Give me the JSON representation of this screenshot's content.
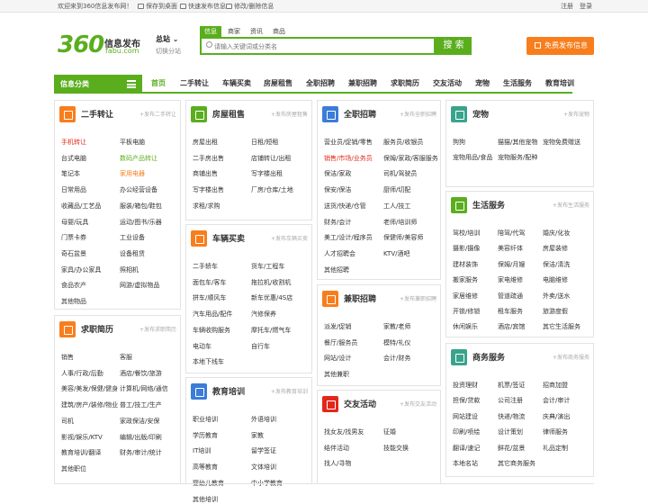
{
  "topbar": {
    "welcome": "欢迎来到360信息发布网！",
    "save_desktop": "保存到桌面",
    "quick_publish": "快速发布信息",
    "edit_delete": "修改/删除信息",
    "register": "注册",
    "login": "登录"
  },
  "logo": {
    "num": "360",
    "cn": "信息发布",
    "en": "fabu.com"
  },
  "city": {
    "name": "总站",
    "switch": "切换分站"
  },
  "search": {
    "tabs": [
      "信息",
      "商家",
      "资讯",
      "商品"
    ],
    "placeholder": "请输入关键词或分类名",
    "button": "搜 索"
  },
  "publish_button": "免费发布信息",
  "category_bar": "信息分类",
  "nav": [
    "首页",
    "二手转让",
    "车辆买卖",
    "房屋租售",
    "全职招聘",
    "兼职招聘",
    "求职简历",
    "交友活动",
    "宠物",
    "生活服务",
    "教育培训"
  ],
  "colors": {
    "brand": "#5aae1e",
    "orange": "#f87e1d",
    "red": "#e3281b"
  },
  "sections": {
    "ershou": {
      "title": "二手转让",
      "pub": "+发布二手转让",
      "icon": "cart-icon",
      "items": [
        "手机转让",
        "平板电脑",
        "台式电脑",
        "数码产品转让",
        "笔记本",
        "家用电器",
        "日常用品",
        "办公经营设备",
        "收藏品/工艺品",
        "服装/箱包/鞋包",
        "母婴/玩具",
        "运动/图书/乐器",
        "门票卡券",
        "工业设备",
        "奇石盆景",
        "设备租赁",
        "家具/办公家具",
        "照相机",
        "食品农产",
        "网游/虚拟物品",
        "其他物品"
      ]
    },
    "qiuzhi": {
      "title": "求职简历",
      "pub": "+发布求职简历",
      "icon": "resume-icon",
      "items": [
        "销售",
        "客服",
        "人事/行政/后勤",
        "酒店/餐饮/旅游",
        "美容/美发/保健/健身",
        "计算机/网络/通信",
        "建筑/房产/装修/物业",
        "普工/技工/生产",
        "司机",
        "家政保洁/安保",
        "影视/娱乐/KTV",
        "编辑/出版/印刷",
        "教育培训/翻译",
        "财务/审计/统计",
        "其他职位"
      ]
    },
    "fangwu": {
      "title": "房屋租售",
      "pub": "+发布房屋租售",
      "icon": "house-icon",
      "items": [
        "房屋出租",
        "日租/短租",
        "二手房出售",
        "店铺转让/出租",
        "商铺出售",
        "写字楼出租",
        "写字楼出售",
        "厂房/仓库/土地",
        "求租/求购"
      ]
    },
    "cheliang": {
      "title": "车辆买卖",
      "pub": "+发布车辆买卖",
      "icon": "car-icon",
      "items": [
        "二手轿车",
        "货车/工程车",
        "面包车/客车",
        "拖拉机/收割机",
        "拼车/顺风车",
        "新车优惠/4S店",
        "汽车用品/配件",
        "汽修保养",
        "车辆收购服务",
        "摩托车/燃气车",
        "电动车",
        "自行车",
        "本地下线车"
      ]
    },
    "jiaoyu": {
      "title": "教育培训",
      "pub": "+发布教育培训",
      "icon": "book-icon",
      "items": [
        "职业培训",
        "外语培训",
        "学历教育",
        "家教",
        "IT培训",
        "留学签证",
        "高等教育",
        "文体培训",
        "婴幼儿教育",
        "中小学教育",
        "其他培训"
      ]
    },
    "quanzhi": {
      "title": "全职招聘",
      "pub": "+发布全职招聘",
      "icon": "search-person-icon",
      "items": [
        "营业员/促销/零售",
        "服务员/收银员",
        "销售/市场/业务员",
        "保姆/家政/客服服务",
        "保洁/家政",
        "司机/驾驶员",
        "保安/保洁",
        "厨师/切配",
        "送货/快递/仓管",
        "工人/技工",
        "财务/会计",
        "老师/培训师",
        "美工/设计/程序员",
        "保健师/美容师",
        "人才招聘会",
        "KTV/酒吧",
        "其他招聘"
      ]
    },
    "jianzhi": {
      "title": "兼职招聘",
      "pub": "+发布兼职招聘",
      "icon": "clock-icon",
      "items": [
        "派发/促销",
        "家教/老师",
        "餐厅/服务员",
        "模特/礼仪",
        "网站/设计",
        "会计/财务",
        "其他兼职"
      ]
    },
    "jiaoyou": {
      "title": "交友活动",
      "pub": "+发布交友活动",
      "icon": "heart-icon",
      "items": [
        "找女友/找男友",
        "征婚",
        "结伴活动",
        "技能交换",
        "找人/寻物"
      ]
    },
    "chongwu": {
      "title": "宠物",
      "pub": "+发布宠物",
      "icon": "dog-icon",
      "items": [
        "狗狗",
        "猫猫/其他宠物",
        "宠物免费赠送",
        "宠物用品/食品",
        "宠物服务/配种"
      ]
    },
    "shenghuo": {
      "title": "生活服务",
      "pub": "+发布生活服务",
      "icon": "umbrella-icon",
      "items": [
        "驾校/培训",
        "陪驾/代驾",
        "婚庆/化妆",
        "摄影/摄像",
        "美容纤体",
        "房屋装修",
        "建材装饰",
        "保姆/月嫂",
        "保洁/清洗",
        "搬家服务",
        "家电维修",
        "电脑维修",
        "家居维修",
        "管道疏通",
        "外卖/送水",
        "开锁/修锁",
        "租车服务",
        "旅游度假",
        "休闲娱乐",
        "酒店/宾馆",
        "其它生活服务"
      ]
    },
    "shangwu": {
      "title": "商务服务",
      "pub": "+发布商务服务",
      "icon": "handshake-icon",
      "items": [
        "投资理财",
        "机票/签证",
        "招商加盟",
        "担保/贷款",
        "公司注册",
        "会计/审计",
        "网站建设",
        "快递/物流",
        "庆典/演出",
        "印刷/喷绘",
        "设计策划",
        "律师服务",
        "翻译/速记",
        "鲜花/盆景",
        "礼品定制",
        "本地名站",
        "其它商务服务"
      ]
    }
  }
}
